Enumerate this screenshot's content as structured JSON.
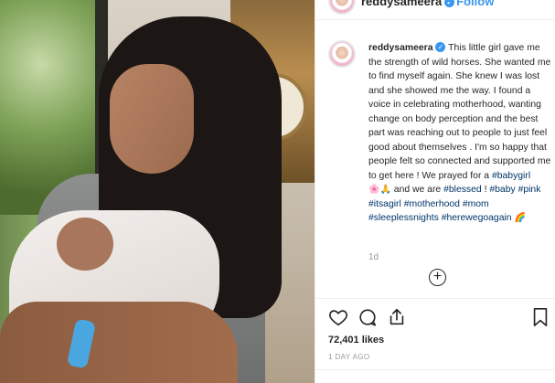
{
  "post": {
    "username": "reddysameera",
    "follow_label": "• Follow",
    "verified_badge": "✓",
    "caption": {
      "username": "reddysameera",
      "text_1": " This little girl gave me the strength of wild horses. She wanted me to find myself again. She knew I was lost and she showed me the way. I found a voice in celebrating motherhood, wanting change on body perception and the best part was reaching out to people to just feel good about themselves . I'm so happy that people felt so connected and supported me to get here ! We prayed for a ",
      "tag_babygirl": "#babygirl",
      "emoji_1": "🌸🙏",
      "text_2": " and we are ",
      "tag_blessed": "#blessed",
      "text_3": " ! ",
      "tag_baby": "#baby",
      "tag_pink": "#pink",
      "tag_itsagirl": "#itsagirl",
      "tag_motherhood": "#motherhood",
      "tag_mom": "#mom",
      "tag_sleeplessnights": "#sleeplessnights",
      "tag_herewegoagain": "#herewegoagain",
      "emoji_2": "🌈"
    },
    "time_ago": "1d",
    "load_more_symbol": "+",
    "likes": "72,401 likes",
    "posted": "1 DAY AGO"
  },
  "icons": {
    "like": "heart-icon",
    "comment": "comment-icon",
    "share": "share-icon",
    "save": "bookmark-icon",
    "load_more": "plus-circle-icon"
  },
  "colors": {
    "link": "#3897f0",
    "hashtag": "#003569",
    "muted": "#999999",
    "text": "#262626"
  }
}
